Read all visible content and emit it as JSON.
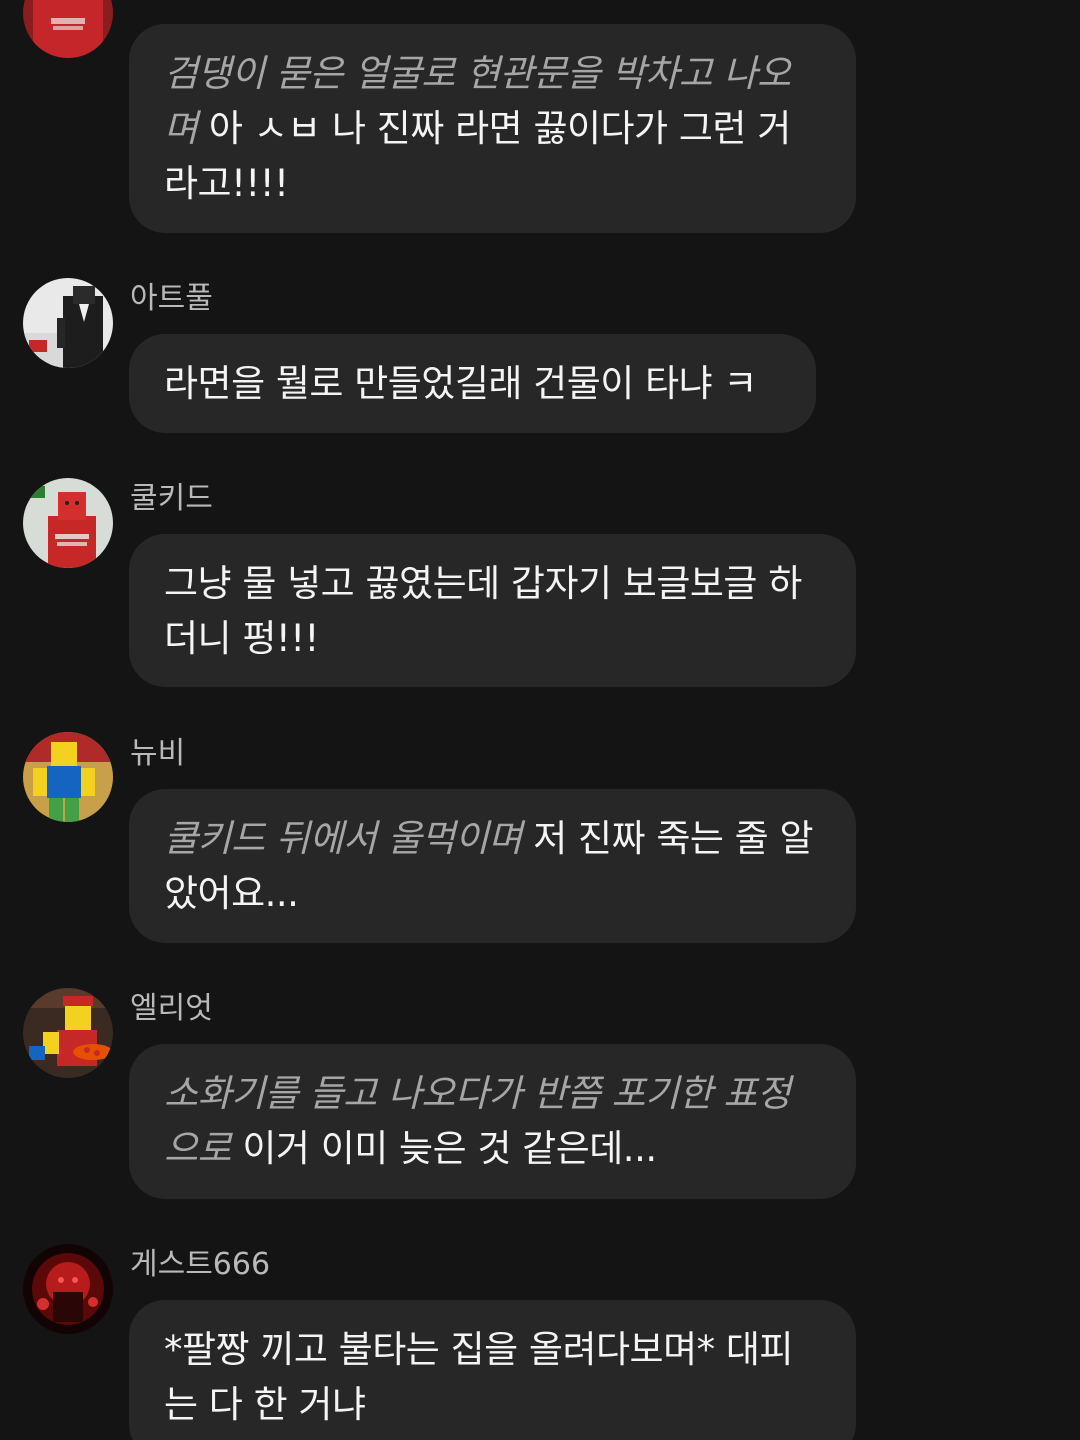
{
  "messages": [
    {
      "author": "",
      "action": "검댕이 묻은 얼굴로 현관문을 박차고 나오며",
      "text": "아 ㅅㅂ 나 진짜 라면 끓이다가 그런 거라고!!!!"
    },
    {
      "author": "아트풀",
      "action": "",
      "text": "라면을 뭘로 만들었길래 건물이 타냐 ㅋ"
    },
    {
      "author": "쿨키드",
      "action": "",
      "text": "그냥 물 넣고 끓였는데 갑자기 보글보글 하더니 펑!!!"
    },
    {
      "author": "뉴비",
      "action": "쿨키드 뒤에서 울먹이며",
      "text": "저 진짜 죽는 줄 알았어요..."
    },
    {
      "author": "엘리엇",
      "action": "소화기를 들고 나오다가 반쯤 포기한 표정으로",
      "text": "이거 이미 늦은 것 같은데..."
    },
    {
      "author": "게스트666",
      "action": "",
      "text": "*팔짱 끼고 불타는 집을 올려다보며* 대피는 다 한 거냐"
    }
  ],
  "avatars": [
    {
      "icon": "red-noob-avatar-icon"
    },
    {
      "icon": "suit-avatar-icon"
    },
    {
      "icon": "red-noob-avatar-icon"
    },
    {
      "icon": "noob-avatar-icon"
    },
    {
      "icon": "pizza-avatar-icon"
    },
    {
      "icon": "dark-red-avatar-icon"
    }
  ]
}
